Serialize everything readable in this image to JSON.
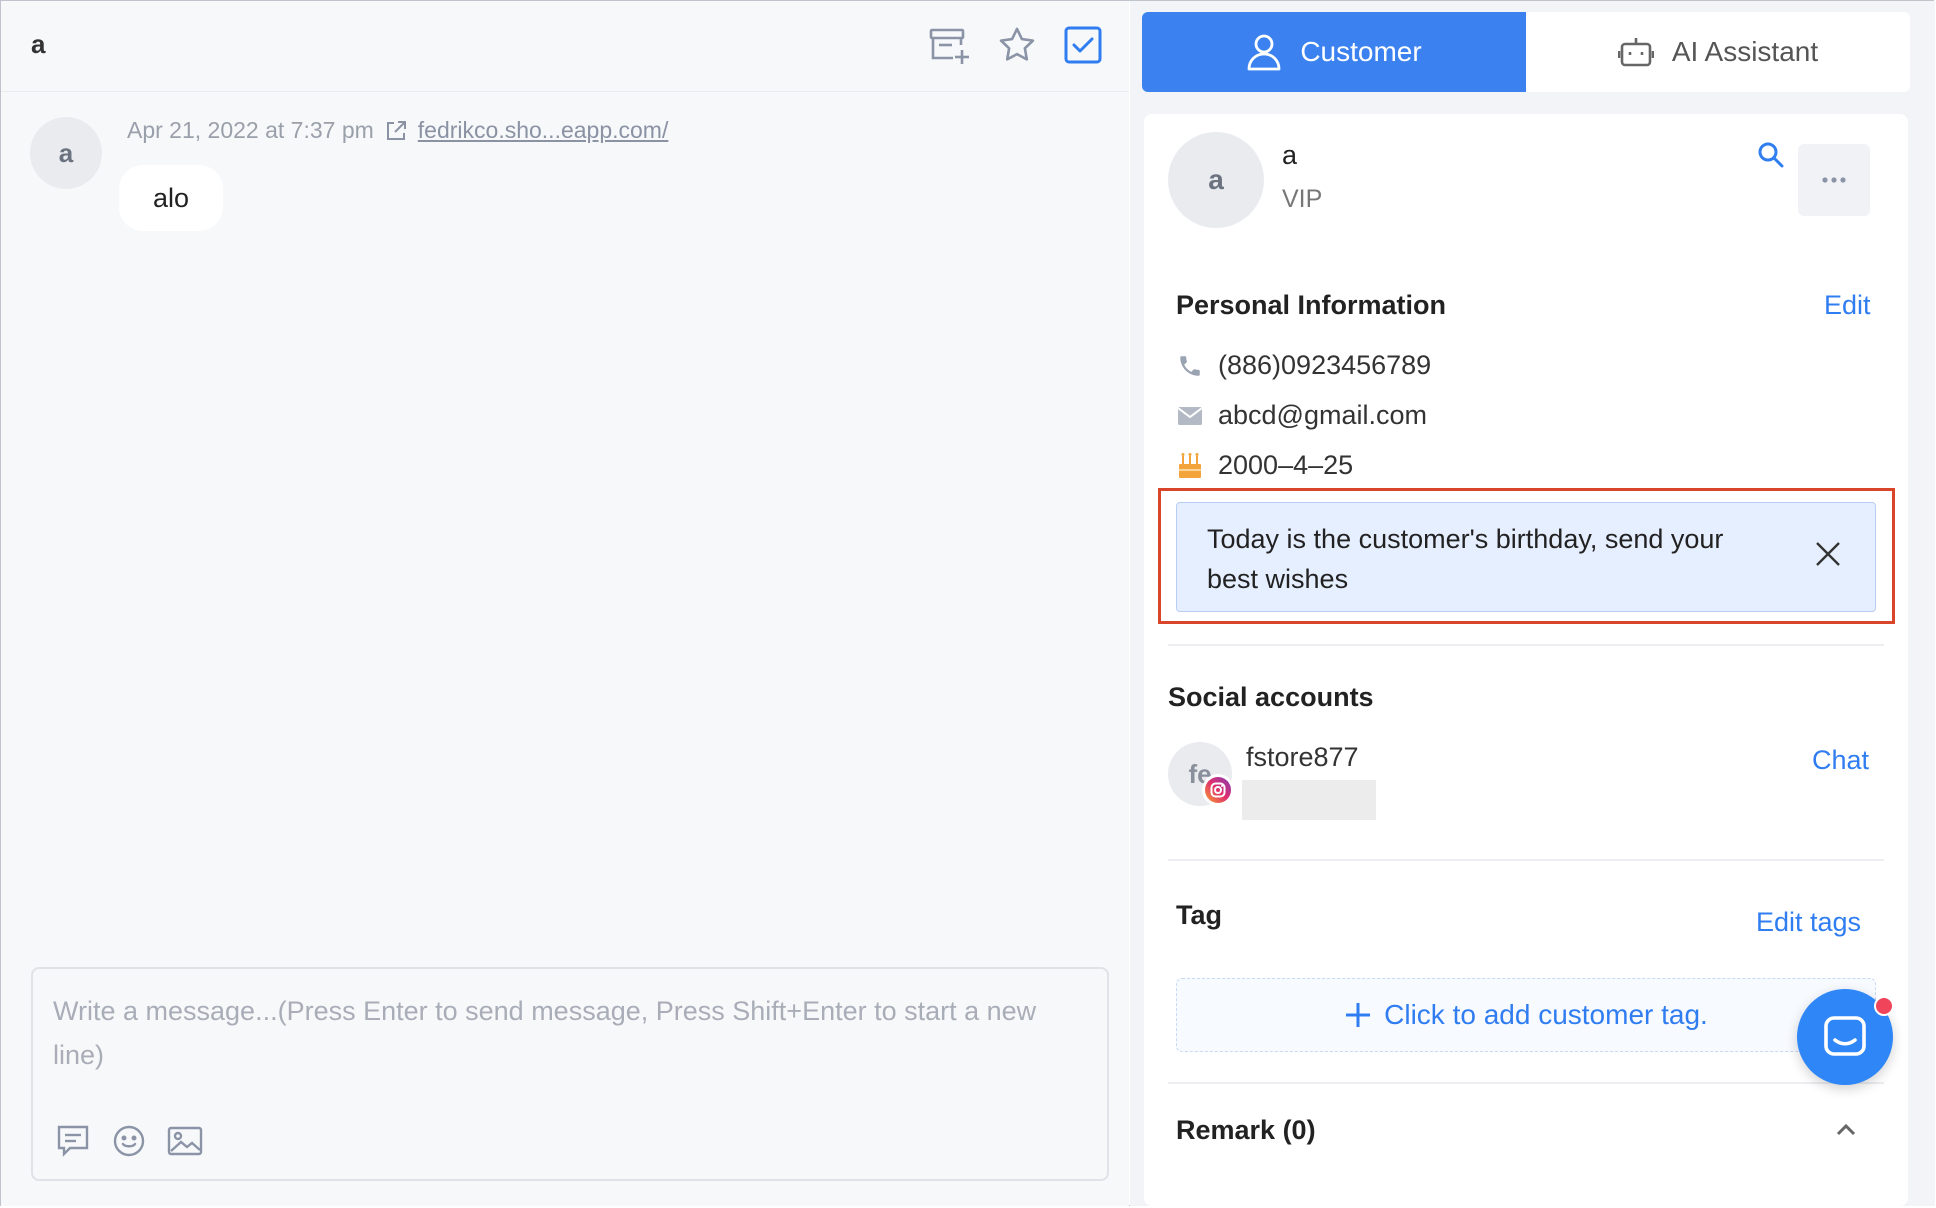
{
  "chat": {
    "title": "a",
    "message": {
      "avatar_initial": "a",
      "timestamp": "Apr 21, 2022 at 7:37 pm",
      "link_text": "fedrikco.sho...eapp.com/",
      "text": "alo"
    },
    "composer": {
      "placeholder": "Write a message...(Press Enter to send message, Press Shift+Enter to start a new line)"
    },
    "header_icons": [
      "add-to-list-icon",
      "star-icon",
      "checkbox-icon"
    ],
    "composer_icons": [
      "quick-reply-icon",
      "emoji-icon",
      "image-icon"
    ]
  },
  "tabs": {
    "customer": "Customer",
    "ai_assistant": "AI Assistant"
  },
  "customer": {
    "avatar_initial": "a",
    "name": "a",
    "level": "VIP",
    "personal_info": {
      "title": "Personal Information",
      "edit_label": "Edit",
      "phone": "(886)0923456789",
      "email": "abcd@gmail.com",
      "birthday": "2000–4–25"
    },
    "birthday_notice": "Today is the customer's birthday, send your best wishes",
    "social": {
      "title": "Social accounts",
      "avatar_initial": "fe",
      "account_name": "fstore877",
      "chat_label": "Chat"
    },
    "tag": {
      "title": "Tag",
      "edit_label": "Edit tags",
      "add_label": "Click to add customer tag."
    },
    "remark": {
      "title": "Remark (0)"
    }
  },
  "colors": {
    "accent": "#3b82f0",
    "link": "#2f7df0",
    "highlight_outline": "#d9452b",
    "notice_bg": "#e6efff",
    "notification_dot": "#f0445a"
  }
}
